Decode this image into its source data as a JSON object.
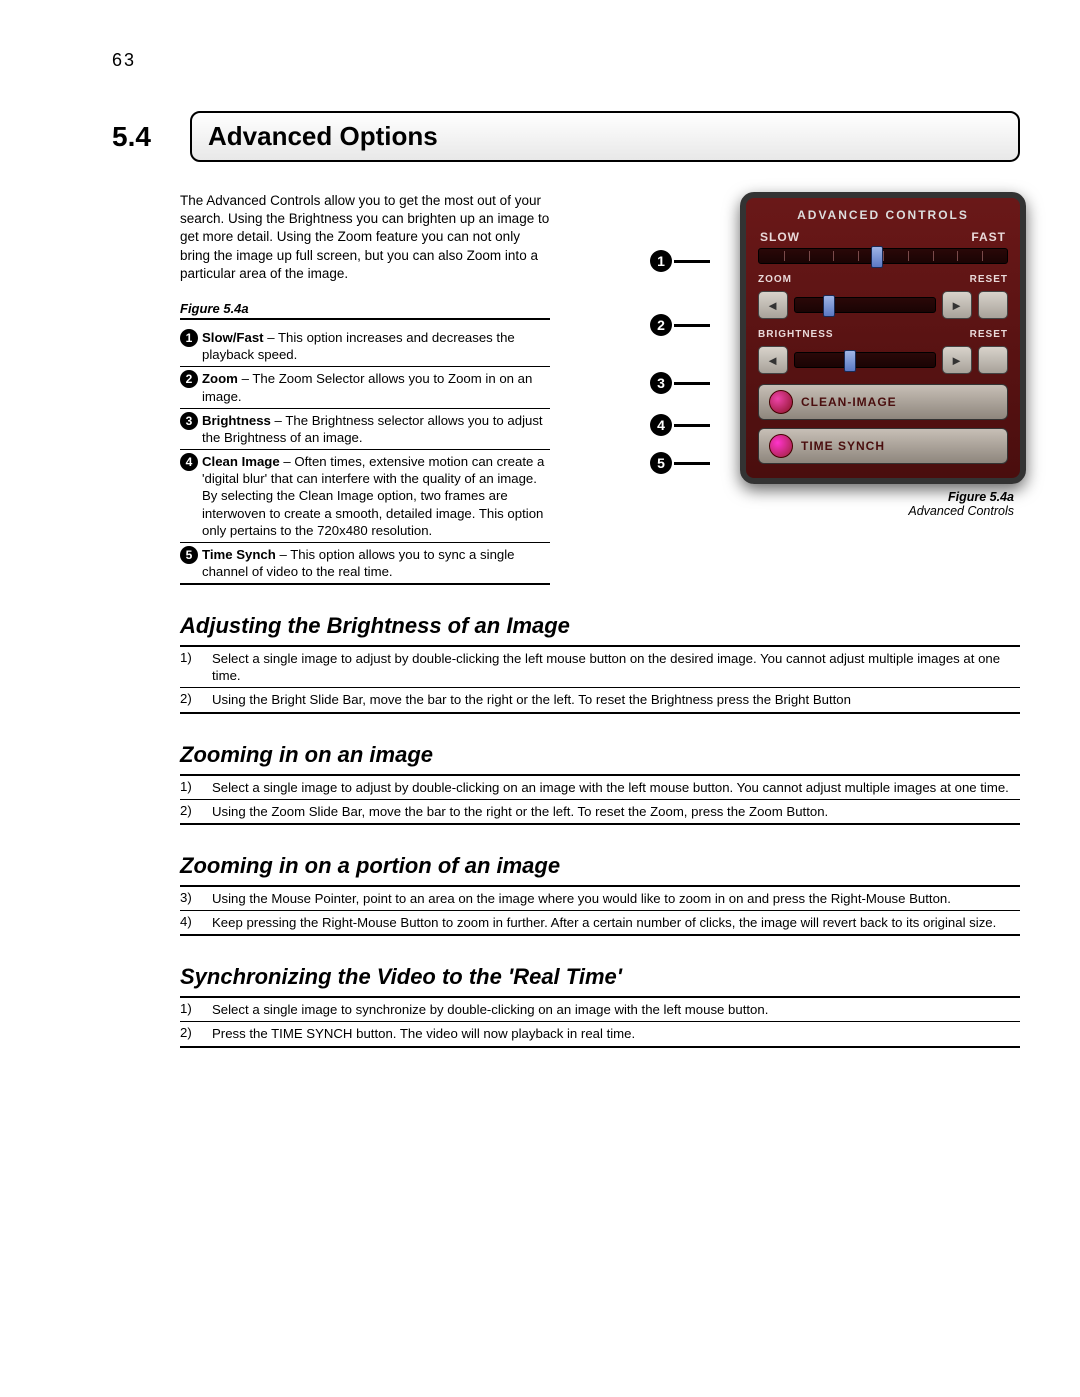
{
  "page_number": "63",
  "section_number": "5.4",
  "section_title": "Advanced Options",
  "intro": "The Advanced Controls allow you to get the most out of your search. Using the Brightness you can brighten up an image to get more detail. Using the Zoom feature you can not only bring the image up full screen, but you can also Zoom into a particular area of the image.",
  "figure_label": "Figure 5.4a",
  "legend": [
    {
      "n": "1",
      "b": "Slow/Fast",
      "t": " – This option increases and decreases the playback speed."
    },
    {
      "n": "2",
      "b": "Zoom",
      "t": " – The Zoom Selector allows you to Zoom in on an image."
    },
    {
      "n": "3",
      "b": "Brightness",
      "t": " – The Brightness selector allows you to adjust the Brightness of an image."
    },
    {
      "n": "4",
      "b": "Clean Image",
      "t": " – Often times, extensive motion can create a 'digital blur' that can interfere with the quality of an image. By selecting the Clean Image option, two frames are interwoven to create a smooth, detailed image. This option only pertains to the 720x480 resolution."
    },
    {
      "n": "5",
      "b": "Time Synch",
      "t": " – This option allows you to sync a single channel of video to the real time."
    }
  ],
  "panel": {
    "header": "ADVANCED CONTROLS",
    "slow": "SLOW",
    "fast": "FAST",
    "zoom": "ZOOM",
    "reset": "RESET",
    "brightness": "BRIGHTNESS",
    "clean": "CLEAN-IMAGE",
    "time": "TIME SYNCH"
  },
  "figure_caption_label": "Figure 5.4a",
  "figure_caption_desc": "Advanced Controls",
  "callouts": [
    "1",
    "2",
    "3",
    "4",
    "5"
  ],
  "subs": [
    {
      "title": "Adjusting the Brightness of an Image",
      "steps": [
        {
          "n": "1)",
          "t": "Select a single image to adjust by double-clicking the left mouse button on the desired image. You cannot adjust multiple images at one time."
        },
        {
          "n": "2)",
          "t": "Using the Bright Slide Bar, move the bar to the right or the left. To reset the Brightness press the Bright Button"
        }
      ]
    },
    {
      "title": "Zooming in on an image",
      "steps": [
        {
          "n": "1)",
          "t": "Select a single image to adjust by double-clicking on an image with the left mouse button. You cannot adjust multiple images at one time."
        },
        {
          "n": "2)",
          "t": "Using the Zoom Slide Bar, move the bar to the right or the left. To reset the Zoom, press the Zoom Button."
        }
      ]
    },
    {
      "title": "Zooming in on a portion of an image",
      "steps": [
        {
          "n": "3)",
          "t": "Using the Mouse Pointer, point to an area on the image where you would like to zoom in on and press the Right-Mouse Button."
        },
        {
          "n": "4)",
          "t": "Keep pressing the Right-Mouse Button to zoom in further. After a certain number of clicks, the image will revert back to its original size."
        }
      ]
    },
    {
      "title": "Synchronizing the Video to the 'Real Time'",
      "steps": [
        {
          "n": "1)",
          "t": "Select a single image to synchronize by double-clicking on an image with the left mouse button."
        },
        {
          "n": "2)",
          "t": "Press the TIME SYNCH button. The video will now playback in real time."
        }
      ]
    }
  ]
}
